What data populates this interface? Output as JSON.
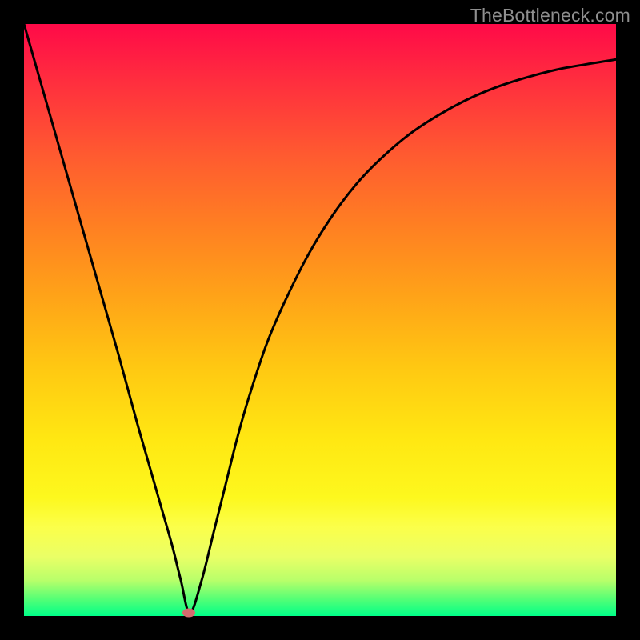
{
  "watermark": "TheBottleneck.com",
  "chart_data": {
    "type": "line",
    "title": "",
    "xlabel": "",
    "ylabel": "",
    "xlim": [
      0,
      100
    ],
    "ylim": [
      0,
      100
    ],
    "x": [
      0,
      4,
      8,
      12,
      16,
      19,
      21,
      23,
      25,
      26.5,
      28,
      30,
      32,
      34,
      36,
      38,
      41,
      44,
      48,
      52,
      56,
      60,
      65,
      70,
      75,
      80,
      85,
      90,
      95,
      100
    ],
    "y": [
      100,
      86,
      72,
      58,
      44,
      33,
      26,
      19,
      12,
      6,
      0.5,
      6,
      14,
      22,
      30,
      37,
      46,
      53,
      61,
      67.5,
      72.8,
      77,
      81.3,
      84.6,
      87.3,
      89.4,
      91.0,
      92.3,
      93.2,
      94.0
    ],
    "marker": {
      "x": 27.8,
      "y": 0.6
    }
  },
  "colors": {
    "curve": "#000000",
    "marker": "#d56b6f",
    "frame": "#000000"
  }
}
